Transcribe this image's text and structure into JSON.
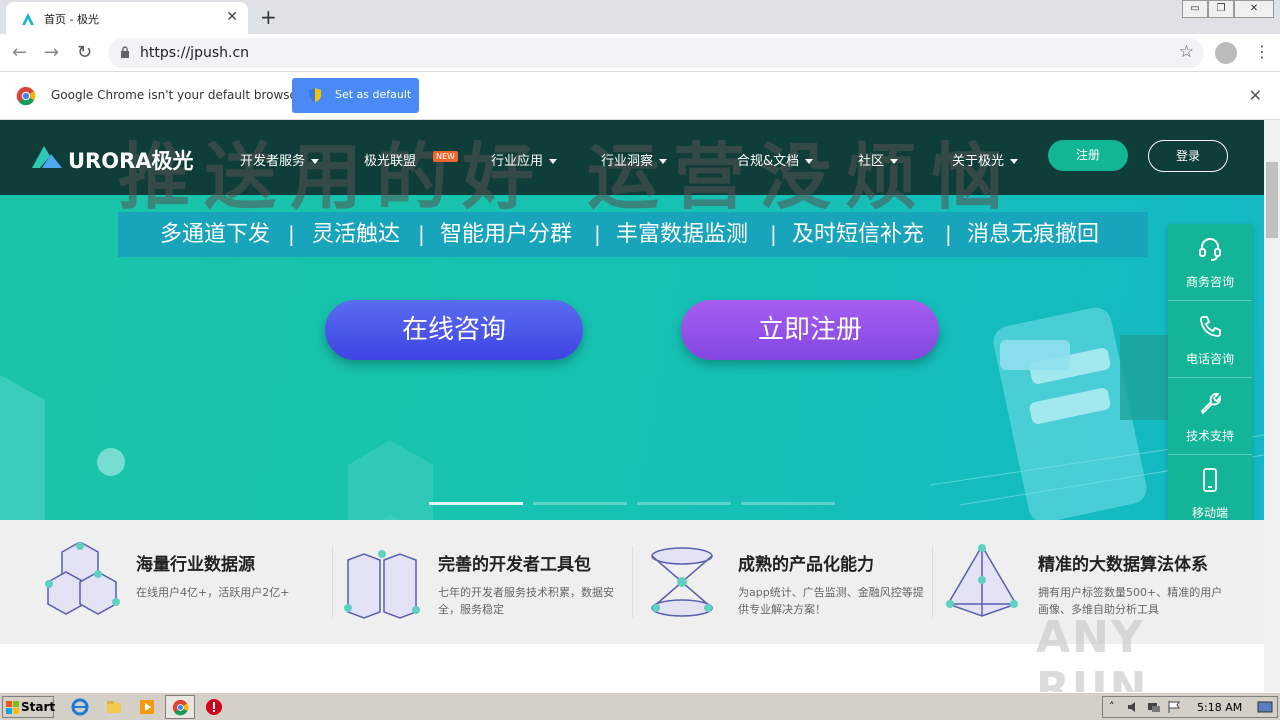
{
  "browser": {
    "tab_title": "首页 - 极光",
    "tab_close": "✕",
    "new_tab": "+",
    "url": "https://jpush.cn",
    "back": "←",
    "forward": "→",
    "reload": "↻",
    "star": "☆",
    "menu": "⋮",
    "window_controls": [
      "▭",
      "❐",
      "✕"
    ]
  },
  "infobar": {
    "message": "Google Chrome isn't your default browser",
    "button": "Set as default",
    "close": "✕"
  },
  "site": {
    "background_slogan": "推送用的好 运营没烦恼",
    "logo_text": "URORA极光",
    "nav": [
      {
        "label": "开发者服务",
        "caret": true
      },
      {
        "label": "极光联盟",
        "badge": "NEW"
      },
      {
        "label": "行业应用",
        "caret": true
      },
      {
        "label": "行业洞察",
        "caret": true
      },
      {
        "label": "合规&文档",
        "caret": true
      },
      {
        "label": "社区",
        "caret": true
      },
      {
        "label": "关于极光",
        "caret": true
      }
    ],
    "register": "注册",
    "login": "登录",
    "features": [
      "多通道下发",
      "灵活触达",
      "智能用户分群",
      "丰富数据监测",
      "及时短信补充",
      "消息无痕撤回"
    ],
    "separator": "|",
    "cta_consult": "在线咨询",
    "cta_register": "立即注册",
    "side_panel": [
      {
        "label": "商务咨询",
        "icon": "headset-icon"
      },
      {
        "label": "电话咨询",
        "icon": "phone-icon"
      },
      {
        "label": "技术支持",
        "icon": "wrench-icon"
      },
      {
        "label": "移动端",
        "icon": "mobile-icon"
      }
    ],
    "cards": [
      {
        "title": "海量行业数据源",
        "desc": "在线用户4亿+，活跃用户2亿+"
      },
      {
        "title": "完善的开发者工具包",
        "desc": "七年的开发者服务技术积累，数据安全，服务稳定"
      },
      {
        "title": "成熟的产品化能力",
        "desc": "为app统计、广告监测、金融风控等提供专业解决方案！"
      },
      {
        "title": "精准的大数据算法体系",
        "desc": "拥有用户标签数量500+、精准的用户画像、多维自助分析工具"
      }
    ],
    "watermark": "ANY RUN"
  },
  "taskbar": {
    "start": "Start",
    "clock": "5:18 AM"
  },
  "colors": {
    "accent_green": "#14b597",
    "hero_teal": "#16c2b2",
    "cta_blue": "#4a55ea",
    "cta_purple": "#9455ea",
    "chrome_blue": "#4a8af4"
  }
}
